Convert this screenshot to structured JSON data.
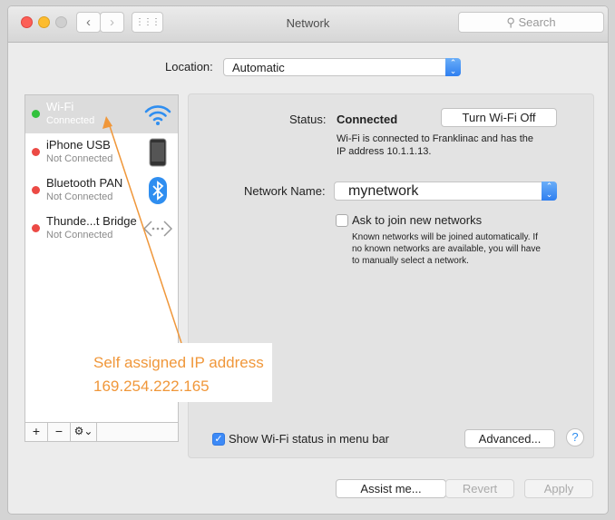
{
  "window": {
    "title": "Network",
    "search_placeholder": "Search"
  },
  "location": {
    "label": "Location:",
    "value": "Automatic"
  },
  "services": [
    {
      "name": "Wi-Fi",
      "status": "Connected",
      "status_color": "#32c13c",
      "icon": "wifi-icon",
      "selected": true
    },
    {
      "name": "iPhone USB",
      "status": "Not Connected",
      "status_color": "#ec4a45",
      "icon": "iphone-icon"
    },
    {
      "name": "Bluetooth PAN",
      "status": "Not Connected",
      "status_color": "#ec4a45",
      "icon": "bluetooth-icon"
    },
    {
      "name": "Thunde...t Bridge",
      "status": "Not Connected",
      "status_color": "#ec4a45",
      "icon": "thunderbolt-bridge-icon"
    }
  ],
  "sidebar_footer": {
    "add": "+",
    "remove": "−",
    "gear": "⚙⌄"
  },
  "detail": {
    "status_label": "Status:",
    "status_value": "Connected",
    "turn_off": "Turn Wi-Fi Off",
    "status_desc_1": "Wi-Fi is connected to Franklinac and has the",
    "status_desc_2": "IP address 10.1.1.13.",
    "network_name_label": "Network Name:",
    "network_name": "mynetwork",
    "ask_join": "Ask to join new networks",
    "ask_join_checked": false,
    "ask_desc_1": "Known networks will be joined automatically. If",
    "ask_desc_2": "no known networks are available, you will have",
    "ask_desc_3": "to manually select a network.",
    "show_status": "Show Wi-Fi status in menu bar",
    "show_status_checked": true,
    "advanced": "Advanced...",
    "help": "?"
  },
  "buttons": {
    "assist": "Assist me...",
    "revert": "Revert",
    "apply": "Apply"
  },
  "annotation": {
    "line1": "Self assigned IP address",
    "line2": "169.254.222.165",
    "color": "#f0973a"
  }
}
